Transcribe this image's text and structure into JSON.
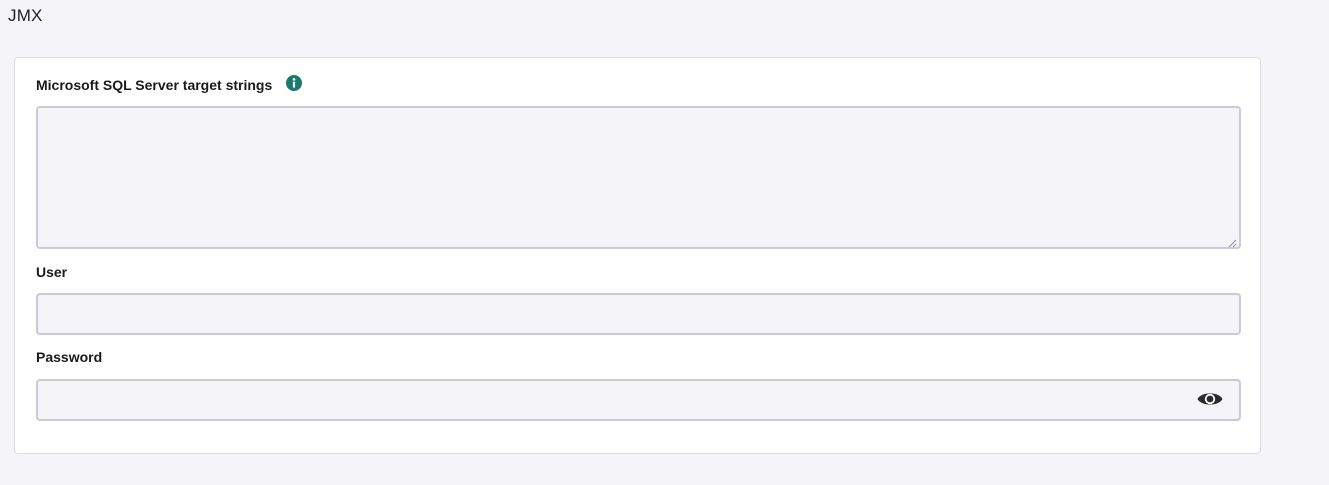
{
  "section": {
    "title": "JMX"
  },
  "form": {
    "target_strings": {
      "label": "Microsoft SQL Server target strings",
      "value": "",
      "placeholder": "",
      "info_icon": "info-icon"
    },
    "user": {
      "label": "User",
      "value": "",
      "placeholder": ""
    },
    "password": {
      "label": "Password",
      "value": "",
      "placeholder": "",
      "toggle_icon": "eye-icon"
    }
  },
  "colors": {
    "accent": "#1a7a6e",
    "input_background": "#f5f5f9",
    "input_border": "#c8cbd6",
    "panel_background": "#ffffff",
    "page_background": "#f5f5f9"
  }
}
